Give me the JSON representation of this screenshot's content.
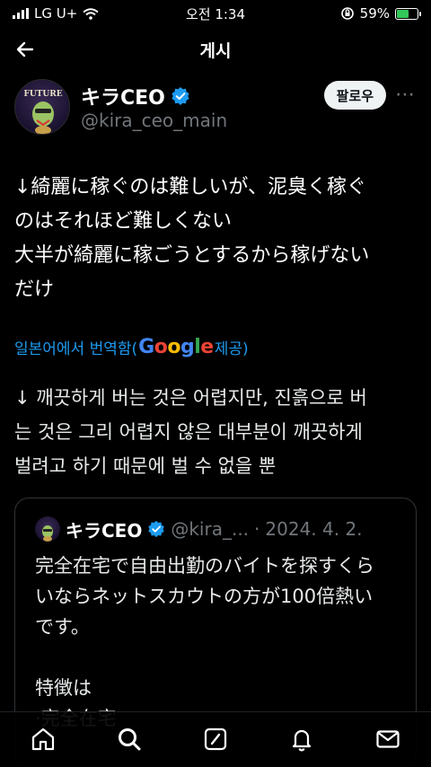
{
  "status_bar": {
    "carrier": "LG U+",
    "time": "오전 1:34",
    "battery_percent": "59%",
    "battery_level": 0.59
  },
  "nav": {
    "title": "게시"
  },
  "author": {
    "display_name": "キラCEO",
    "handle": "@kira_ceo_main",
    "follow_label": "팔로우",
    "avatar_text": "FUTURE"
  },
  "post": {
    "text": "↓綺麗に稼ぐのは難しいが、泥臭く稼ぐ\nのはそれほど難しくない\n大半が綺麗に稼ごうとするから稼げない\nだけ"
  },
  "translation": {
    "label_prefix": "일본어에서 번역함(",
    "provider": "Google",
    "label_suffix": " 제공)",
    "text": "↓ 깨끗하게 버는 것은 어렵지만, 진흙으로 버\n는 것은 그리 어렵지 않은 대부분이 깨끗하게\n벌려고 하기 때문에 벌 수 없을 뿐"
  },
  "quote": {
    "display_name": "キラCEO",
    "handle": "@kira_...",
    "separator": "·",
    "date": "2024. 4. 2.",
    "text": "完全在宅で自由出勤のバイトを探すくら\nいならネットスカウトの方が100倍熱い\nです。\n\n特徴は\n·完全在宅"
  },
  "colors": {
    "accent": "#1d9bf0",
    "verified": "#1d9bf0",
    "battery_green": "#34c759"
  },
  "tabs": [
    {
      "icon": "home-icon"
    },
    {
      "icon": "search-icon"
    },
    {
      "icon": "compose-icon"
    },
    {
      "icon": "bell-icon"
    },
    {
      "icon": "mail-icon"
    }
  ]
}
